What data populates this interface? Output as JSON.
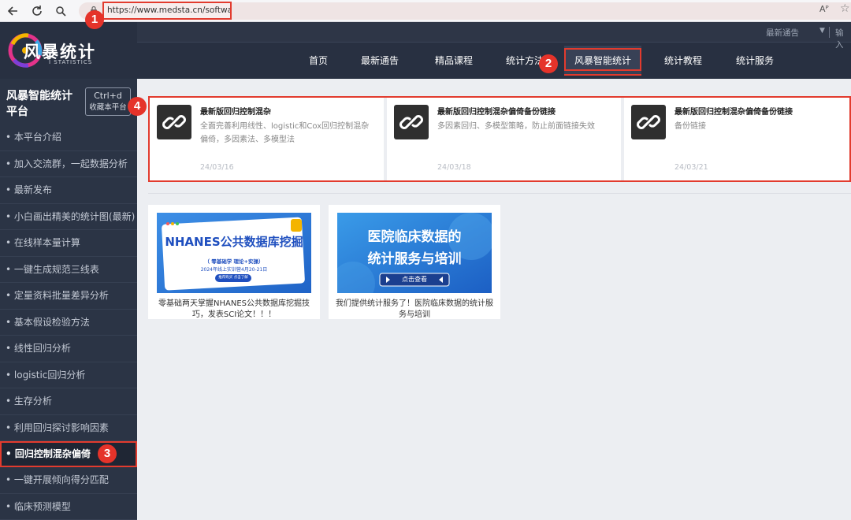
{
  "browser": {
    "url": "https://www.medsta.cn/software",
    "read_aloud": "Aᴾ"
  },
  "header": {
    "logo_text": "风暴统计",
    "logo_sub": "I STATISTICS",
    "notice_label": "最新通告",
    "notice_input": "输入",
    "nav": [
      {
        "label": "首页"
      },
      {
        "label": "最新通告"
      },
      {
        "label": "精品课程"
      },
      {
        "label": "统计方法"
      },
      {
        "label": "风暴智能统计"
      },
      {
        "label": "统计教程"
      },
      {
        "label": "统计服务"
      }
    ]
  },
  "sidebar": {
    "title": "风暴智能统计平台",
    "bookmark_key": "Ctrl+d",
    "bookmark_text": "收藏本平台",
    "items": [
      "• 本平台介绍",
      "• 加入交流群，一起数据分析",
      "• 最新发布",
      "• 小白画出精美的统计图(最新)",
      "• 在线样本量计算",
      "• 一键生成规范三线表",
      "• 定量资料批量差异分析",
      "• 基本假设检验方法",
      "• 线性回归分析",
      "• logistic回归分析",
      "• 生存分析",
      "• 利用回归探讨影响因素",
      "• 回归控制混杂偏倚",
      "• 一键开展倾向得分匹配",
      "• 临床预测模型"
    ]
  },
  "cards": [
    {
      "title": "最新版回归控制混杂",
      "desc": "全面完善利用线性、logistic和Cox回归控制混杂偏倚，多因素法、多模型法",
      "date": "24/03/16"
    },
    {
      "title": "最新版回归控制混杂偏倚备份链接",
      "desc": "多因素回归、多模型策略，防止前面链接失效",
      "date": "24/03/18"
    },
    {
      "title": "最新版回归控制混杂偏倚备份链接",
      "desc": "备份链接",
      "date": "24/03/21"
    }
  ],
  "promos": [
    {
      "banner_title": "NHANES公共数据库挖掘",
      "banner_sub": "（ 零基础学 理论+实操）",
      "banner_date": "2024年线上实训营4月20-21日",
      "banner_btn": "推荐购买 点击了解",
      "caption": "零基础两天掌握NHANES公共数据库挖掘技巧，发表SCI论文！！！"
    },
    {
      "banner_line1": "医院临床数据的",
      "banner_line2": "统计服务与培训",
      "banner_btn": "点击查看",
      "caption": "我们提供统计服务了！医院临床数据的统计服务与培训"
    }
  ],
  "badges": [
    "1",
    "2",
    "3",
    "4"
  ],
  "colors": {
    "highlight": "#e23b2e",
    "badge": "#e5332a",
    "header_bg": "#283041",
    "sidebar_bg": "#2b3445"
  }
}
